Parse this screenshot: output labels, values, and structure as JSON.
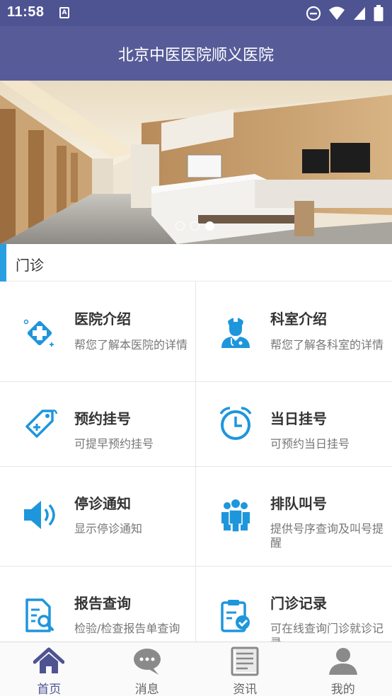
{
  "status_bar": {
    "time": "11:58"
  },
  "header": {
    "title": "北京中医医院顺义医院"
  },
  "banner": {
    "slide_count": 3,
    "active_slide": 3
  },
  "section": {
    "title": "门诊"
  },
  "services": [
    {
      "title": "医院介绍",
      "desc": "帮您了解本医院的详情",
      "icon": "hospital-cross-icon"
    },
    {
      "title": "科室介绍",
      "desc": "帮您了解各科室的详情",
      "icon": "doctor-icon"
    },
    {
      "title": "预约挂号",
      "desc": "可提早预约挂号",
      "icon": "tag-icon"
    },
    {
      "title": "当日挂号",
      "desc": "可预约当日挂号",
      "icon": "alarm-clock-icon"
    },
    {
      "title": "停诊通知",
      "desc": "显示停诊通知",
      "icon": "speaker-icon"
    },
    {
      "title": "排队叫号",
      "desc": "提供号序查询及叫号提醒",
      "icon": "people-queue-icon"
    },
    {
      "title": "报告查询",
      "desc": "检验/检查报告单查询",
      "icon": "report-search-icon"
    },
    {
      "title": "门诊记录",
      "desc": "可在线查询门诊就诊记录",
      "icon": "clipboard-check-icon"
    }
  ],
  "bottom_nav": [
    {
      "label": "首页",
      "icon": "home-icon",
      "active": true
    },
    {
      "label": "消息",
      "icon": "chat-icon",
      "active": false
    },
    {
      "label": "资讯",
      "icon": "news-icon",
      "active": false
    },
    {
      "label": "我的",
      "icon": "user-icon",
      "active": false
    }
  ],
  "colors": {
    "header": "#575c99",
    "status_bar": "#4e5392",
    "accent": "#2a9fe0",
    "icon": "#1e96dc",
    "nav_active": "#4e5392",
    "nav_inactive": "#8a8a8a"
  }
}
